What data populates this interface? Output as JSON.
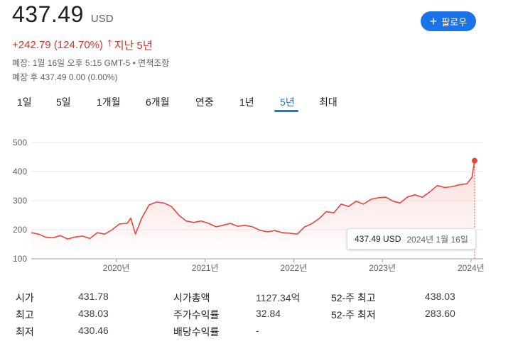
{
  "quote": {
    "price": "437.49",
    "currency": "USD",
    "change": "+242.79 (124.70%)",
    "period": "지난 5년",
    "close_info": "폐장: 1월 16일 오후 5:15 GMT-5 • 면책조항",
    "after_hours": "폐장 후 437.49 0.00 (0.00%)"
  },
  "follow_button": {
    "label": "팔로우"
  },
  "tabs": [
    "1일",
    "5일",
    "1개월",
    "6개월",
    "연중",
    "1년",
    "5년",
    "최대"
  ],
  "active_tab": "5년",
  "tooltip": {
    "price": "437.49 USD",
    "date": "2024년 1월 16일"
  },
  "colors": {
    "line": "#e8453c",
    "accent": "#1a73e8",
    "negative": "#d93025"
  },
  "chart_data": {
    "type": "line",
    "title": "",
    "xlabel": "",
    "ylabel": "",
    "x_ticks": [
      "2020년",
      "2021년",
      "2022년",
      "2023년",
      "2024년"
    ],
    "y_ticks": [
      500,
      400,
      300,
      200,
      100
    ],
    "ylim": [
      100,
      500
    ],
    "xlim": [
      "2019-01-16",
      "2024-01-16"
    ],
    "grid": true,
    "series": [
      {
        "x": [
          "2019-01-16",
          "2019-02-15",
          "2019-03-15",
          "2019-04-15",
          "2019-05-15",
          "2019-06-15",
          "2019-07-15",
          "2019-08-15",
          "2019-09-15",
          "2019-10-15",
          "2019-11-15",
          "2019-12-15",
          "2020-01-15",
          "2020-02-15",
          "2020-03-01",
          "2020-03-20",
          "2020-04-15",
          "2020-05-15",
          "2020-06-15",
          "2020-07-15",
          "2020-08-15",
          "2020-09-15",
          "2020-10-15",
          "2020-11-15",
          "2020-12-15",
          "2021-01-15",
          "2021-02-15",
          "2021-03-15",
          "2021-04-15",
          "2021-05-15",
          "2021-06-15",
          "2021-07-15",
          "2021-08-15",
          "2021-09-15",
          "2021-10-15",
          "2021-11-15",
          "2021-12-15",
          "2022-01-15",
          "2022-02-15",
          "2022-03-15",
          "2022-04-15",
          "2022-05-15",
          "2022-06-15",
          "2022-07-15",
          "2022-08-15",
          "2022-09-15",
          "2022-10-15",
          "2022-11-15",
          "2022-12-15",
          "2023-01-15",
          "2023-02-15",
          "2023-03-15",
          "2023-04-15",
          "2023-05-15",
          "2023-06-15",
          "2023-07-15",
          "2023-08-15",
          "2023-09-15",
          "2023-10-15",
          "2023-11-15",
          "2023-12-15",
          "2024-01-05",
          "2024-01-16"
        ],
        "y": [
          190,
          185,
          175,
          172,
          180,
          168,
          175,
          178,
          170,
          190,
          185,
          200,
          220,
          222,
          240,
          185,
          240,
          285,
          295,
          292,
          280,
          250,
          230,
          225,
          230,
          222,
          210,
          215,
          222,
          212,
          215,
          210,
          198,
          193,
          197,
          190,
          188,
          185,
          210,
          220,
          238,
          262,
          258,
          288,
          280,
          298,
          288,
          305,
          310,
          312,
          298,
          292,
          313,
          320,
          312,
          330,
          352,
          345,
          348,
          355,
          358,
          380,
          437.49
        ]
      }
    ]
  },
  "stats": [
    {
      "label": "시가",
      "value": "431.78"
    },
    {
      "label": "최고",
      "value": "438.03"
    },
    {
      "label": "최저",
      "value": "430.46"
    },
    {
      "label": "시가총액",
      "value": "1127.34억"
    },
    {
      "label": "주가수익률",
      "value": "32.84"
    },
    {
      "label": "배당수익률",
      "value": "-"
    },
    {
      "label": "52-주 최고",
      "value": "438.03"
    },
    {
      "label": "52-주 최저",
      "value": "283.60"
    }
  ]
}
